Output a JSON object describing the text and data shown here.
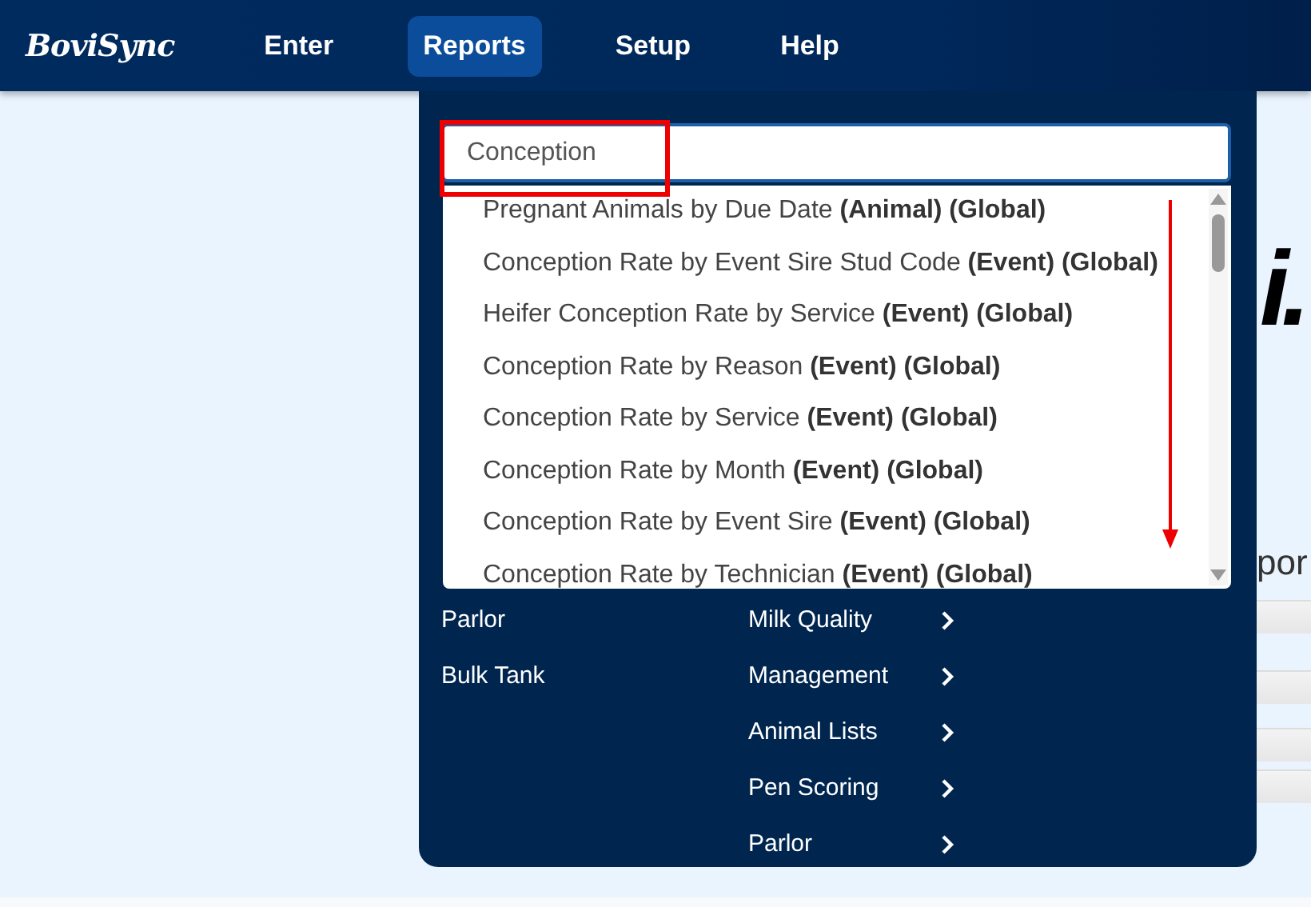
{
  "navbar": {
    "logo": "BoviSync",
    "items": [
      {
        "label": "Enter",
        "selected": false
      },
      {
        "label": "Reports",
        "selected": true
      },
      {
        "label": "Setup",
        "selected": false
      },
      {
        "label": "Help",
        "selected": false
      }
    ]
  },
  "background": {
    "heading_fragment": "i.",
    "text_fragment": "por"
  },
  "reports_menu": {
    "search": {
      "value": "Conception"
    },
    "results": [
      {
        "name": "Pregnant Animals by Due Date",
        "tags": "(Animal) (Global)"
      },
      {
        "name": "Conception Rate by Event Sire Stud Code",
        "tags": "(Event) (Global)"
      },
      {
        "name": "Heifer Conception Rate by Service",
        "tags": "(Event) (Global)"
      },
      {
        "name": "Conception Rate by Reason",
        "tags": "(Event) (Global)"
      },
      {
        "name": "Conception Rate by Service",
        "tags": "(Event) (Global)"
      },
      {
        "name": "Conception Rate by Month",
        "tags": "(Event) (Global)"
      },
      {
        "name": "Conception Rate by Event Sire",
        "tags": "(Event) (Global)"
      },
      {
        "name": "Conception Rate by Technician",
        "tags": "(Event) (Global)"
      }
    ],
    "columns": [
      {
        "items": [
          {
            "label": "Parlor",
            "submenu": false
          },
          {
            "label": "Bulk Tank",
            "submenu": false
          }
        ]
      },
      {
        "items": [
          {
            "label": "Milk Quality",
            "submenu": true
          },
          {
            "label": "Management",
            "submenu": true
          },
          {
            "label": "Animal Lists",
            "submenu": true
          },
          {
            "label": "Pen Scoring",
            "submenu": true
          },
          {
            "label": "Parlor",
            "submenu": true
          }
        ]
      }
    ]
  },
  "annotations": {
    "highlight_box": true,
    "scroll_arrow": true
  }
}
